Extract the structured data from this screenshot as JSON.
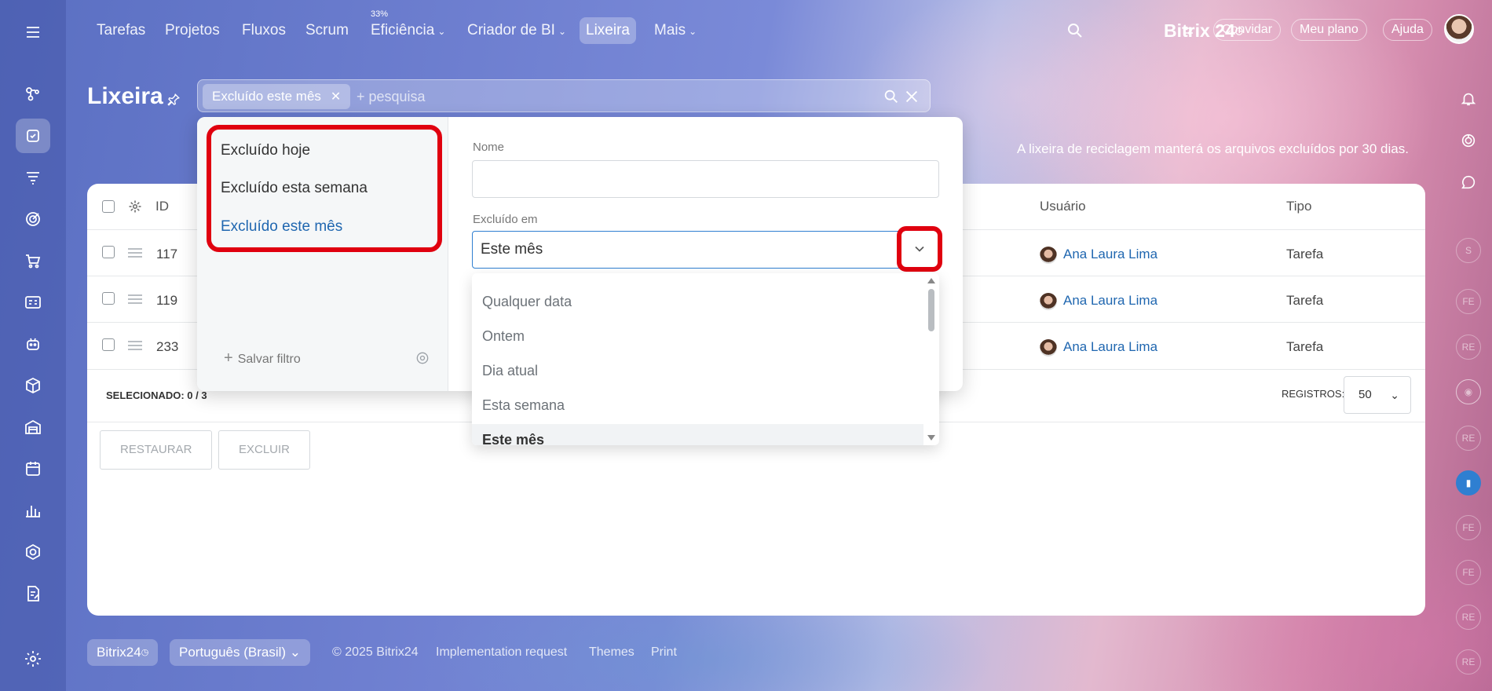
{
  "nav": {
    "items": [
      {
        "label": "Tarefas"
      },
      {
        "label": "Projetos"
      },
      {
        "label": "Fluxos"
      },
      {
        "label": "Scrum"
      },
      {
        "label": "Eficiência",
        "badge": "33%"
      },
      {
        "label": "Criador de BI"
      },
      {
        "label": "Lixeira"
      },
      {
        "label": "Mais"
      }
    ],
    "brand": "Bitrix 24",
    "invite": "Convidar",
    "plan": "Meu plano",
    "help": "Ajuda"
  },
  "page": {
    "title": "Lixeira",
    "notice": "A lixeira de reciclagem manterá os arquivos excluídos por 30 dias."
  },
  "filter": {
    "chip": "Excluído este mês",
    "placeholder": "+ pesquisa",
    "presets": [
      "Excluído hoje",
      "Excluído esta semana",
      "Excluído este mês"
    ],
    "save": "Salvar filtro",
    "name_label": "Nome",
    "name_value": "",
    "deleted_label": "Excluído em",
    "deleted_value": "Este mês",
    "options": [
      "Qualquer data",
      "Ontem",
      "Dia atual",
      "Esta semana",
      "Este mês"
    ]
  },
  "table": {
    "headers": {
      "id": "ID",
      "user": "Usuário",
      "type": "Tipo"
    },
    "rows": [
      {
        "id": "117",
        "user": "Ana Laura Lima",
        "type": "Tarefa"
      },
      {
        "id": "119",
        "user": "Ana Laura Lima",
        "type": "Tarefa"
      },
      {
        "id": "233",
        "user": "Ana Laura Lima",
        "type": "Tarefa"
      }
    ],
    "selected_label": "SELECIONADO:",
    "selected_value": "0 / 3",
    "records_label": "REGISTROS:",
    "records_value": "50",
    "restore": "RESTAURAR",
    "delete": "EXCLUIR"
  },
  "right_rail": [
    "S",
    "FE",
    "RE",
    "RE",
    "FE",
    "FE",
    "RE",
    "RE"
  ],
  "footer": {
    "brand": "Bitrix24",
    "language": "Português (Brasil)",
    "copyright": "© 2025 Bitrix24",
    "links": [
      "Implementation request",
      "Themes",
      "Print"
    ]
  },
  "colors": {
    "accent": "#2067b0",
    "highlight": "#e0000f"
  }
}
